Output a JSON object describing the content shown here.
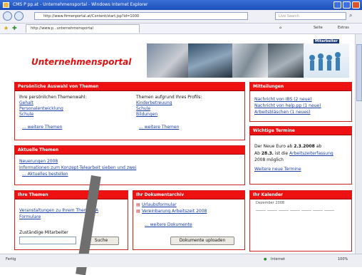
{
  "window": {
    "title": "CMS P pp.at - Unternehmensportal - Windows Internet Explorer"
  },
  "navbar": {
    "address": "http://www.firmenportal.at/Content/start.jsp?id=1000",
    "search_placeholder": "Live Search"
  },
  "tabs": {
    "active_label": "http://www.p...unternehmensportal"
  },
  "commandbar": {
    "page_label": "Seite",
    "tools_label": "Extras"
  },
  "header": {
    "portal_title": "Unternehmensportal",
    "brand": "Mitarbeiter"
  },
  "panels": {
    "personal": {
      "title": "Persönliche Auswahl von Themen",
      "left_heading": "Ihre persönlichen Themenwahl:",
      "left_links": [
        "Gehalt",
        "Personalentwicklung",
        "Schule"
      ],
      "left_more": "... weitere Themen",
      "right_heading": "Themen aufgrund Ihres Profils:",
      "right_links": [
        "Kinderbetreuung",
        "Schule",
        "Bildungen"
      ],
      "right_more": "... weitere Themen"
    },
    "news": {
      "title": "Aktuelle Themen",
      "lines": [
        "Neuerungen 2008",
        "Informationen zum Konzept-Telearbeit sieben und zwei",
        "... Aktuelles bestellen"
      ]
    },
    "my_topics": {
      "title": "Ihre Themen",
      "links": [
        "Veranstaltungen zu Ihrem Thema ITA",
        "Formulare"
      ],
      "input_label": "Zuständige Mitarbeiter",
      "search_button": "Suche"
    },
    "documents": {
      "title": "Ihr Dokumentarchiv",
      "links": [
        "Urlaubsformular",
        "Vereinbarung Arbeitszeit 2008"
      ],
      "more": "... weitere Dokumente",
      "upload_button": "Dokumente uploaden"
    },
    "messages": {
      "title": "Mitteilungen",
      "links": [
        "Nachricht von IBS (2 neue)",
        "Nachricht von help.pp (1 neue)",
        "Arbeitsbläschen (1 neues)"
      ]
    },
    "dates": {
      "title": "Wichtige Termine",
      "text1_pre": "Der Neue Euro ab",
      "text1_date": "2.3.2008",
      "text1_post": "ab",
      "text2_pre": "Ab",
      "text2_date": "28.3.",
      "text2_post": "ist die",
      "text2_link": "Arbeitszeiterfassung",
      "text3": "2008 möglich",
      "more": "Weitere neue Termine"
    },
    "calendar": {
      "title": "Ihr Kalender",
      "month": "Dezember 2008"
    }
  },
  "statusbar": {
    "left_text": "Fertig",
    "zone_text": "Internet",
    "zoom_text": "100%"
  }
}
